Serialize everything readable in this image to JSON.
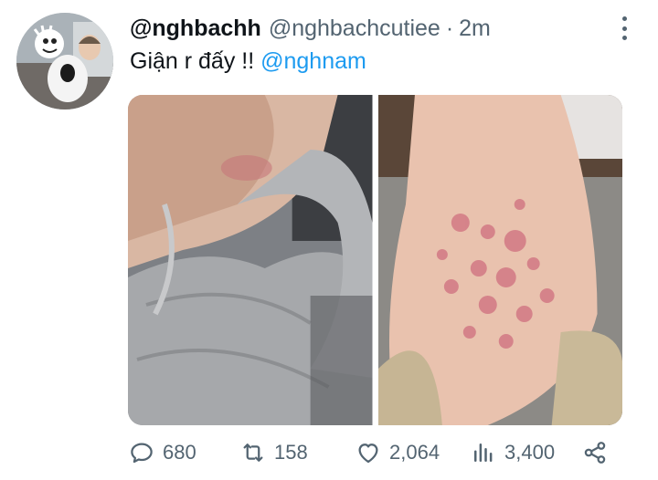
{
  "tweet": {
    "display_name": "@nghbachh",
    "handle": "@nghbachcutiee",
    "separator": "·",
    "time": "2m",
    "text": "Giận r đấy !!",
    "mention": "@nghnam"
  },
  "actions": {
    "replies": "680",
    "retweets": "158",
    "likes": "2,064",
    "views": "3,400"
  },
  "colors": {
    "accent": "#1d9bf0",
    "secondary_text": "#536471"
  },
  "icons": {
    "reply": "reply-icon",
    "retweet": "retweet-icon",
    "like": "heart-icon",
    "views": "views-icon",
    "share": "share-icon",
    "more": "more-icon"
  }
}
